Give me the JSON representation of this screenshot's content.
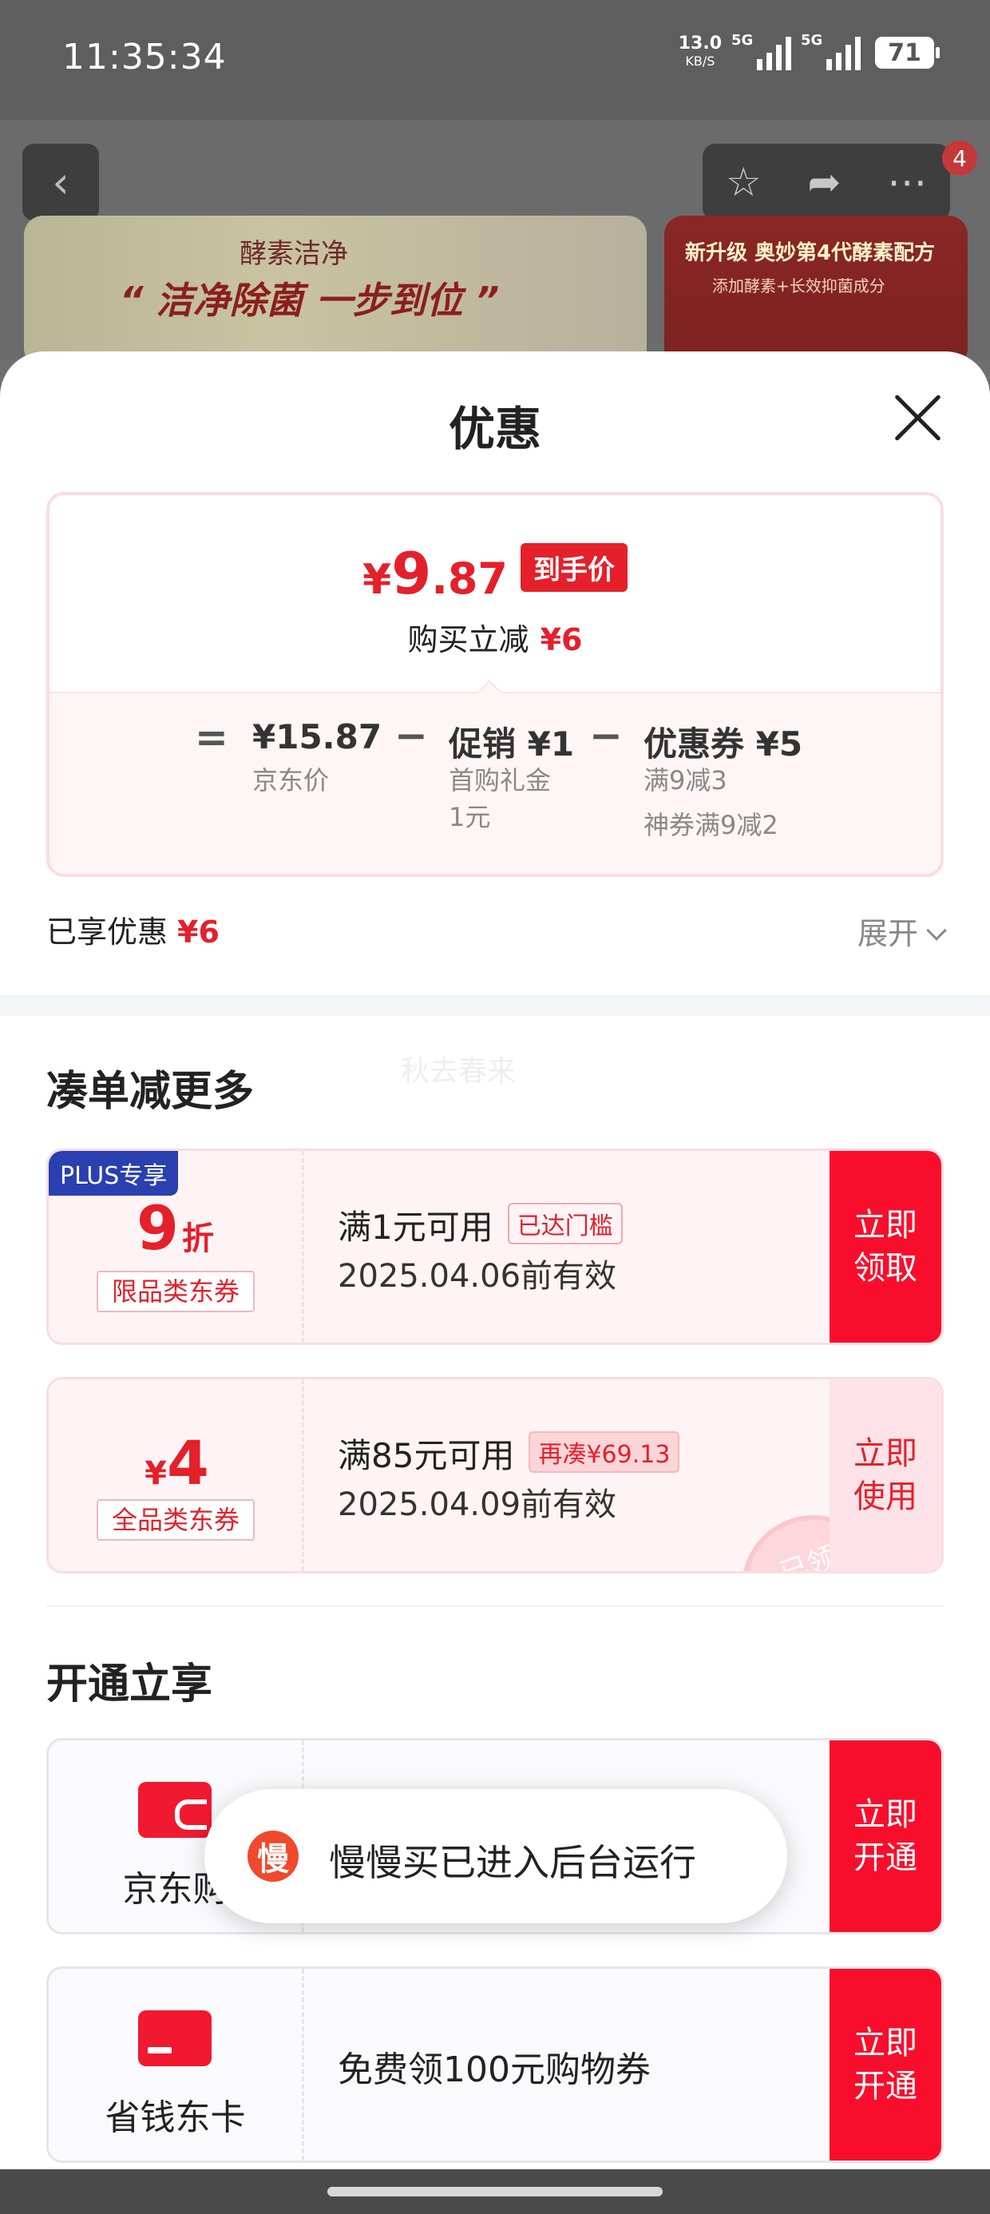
{
  "status_bar": {
    "time": "11:35:34",
    "net_speed": "13.0",
    "net_unit": "KB/S",
    "signal1_label": "5G",
    "signal2_label": "5G",
    "battery": "71"
  },
  "background": {
    "banner_brand": "酵素洁净",
    "banner_slogan": "“ 洁净除菌 一步到位 ”",
    "banner_right_title": "新升级 奥妙第4代酵素配方",
    "banner_right_sub": "添加酵素+长效抑菌成分",
    "cart_badge": "4",
    "icons": [
      "chevron-left-icon",
      "star-icon",
      "share-icon",
      "more-icon"
    ]
  },
  "sheet": {
    "title": "优惠",
    "price": {
      "currency": "¥",
      "integer": "9",
      "decimal": ".87",
      "tag": "到手价",
      "save_label": "购买立减",
      "save_amount": "¥6"
    },
    "breakdown": {
      "eq": "=",
      "minus": "−",
      "jd_price": "¥15.87",
      "jd_label": "京东价",
      "promo": "促销 ¥1",
      "promo_sub1": "首购礼金",
      "promo_sub2": "1元",
      "coupon": "优惠券 ¥5",
      "coupon_sub1": "满9减3",
      "coupon_sub2": "神券满9减2"
    },
    "enjoyed_label": "已享优惠",
    "enjoyed_amount": "¥6",
    "expand_label": "展开",
    "watermark": "秋去春来",
    "section_more": "凑单减更多",
    "coupons": [
      {
        "plus_tag": "PLUS专享",
        "value": "9",
        "unit": "折",
        "category": "限品类东券",
        "condition": "满1元可用",
        "status": "已达门槛",
        "date": "2025.04.06前有效",
        "action": "立即\n领取"
      },
      {
        "currency": "¥",
        "value": "4",
        "category": "全品类东券",
        "condition": "满85元可用",
        "status": "再凑¥69.13",
        "date": "2025.04.09前有效",
        "action": "立即\n使用",
        "stamp": "已领"
      }
    ],
    "section_open": "开通立享",
    "members": [
      {
        "name": "京东购",
        "action": "立即\n开通"
      },
      {
        "name": "省钱东卡",
        "desc": "免费领100元购物券",
        "action": "立即\n开通"
      }
    ]
  },
  "toast": {
    "icon_char": "慢",
    "text": "慢慢买已进入后台运行"
  },
  "colors": {
    "accent_red": "#e4202b",
    "button_red": "#f80e2c",
    "plus_blue": "#2a3fb0"
  }
}
